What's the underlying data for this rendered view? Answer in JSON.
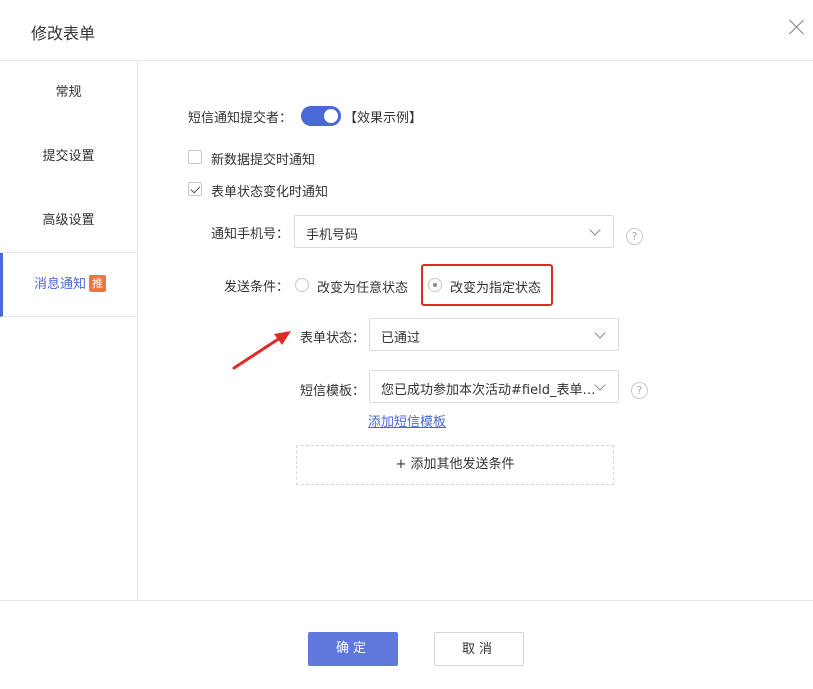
{
  "dialog": {
    "title": "修改表单"
  },
  "sidebar": {
    "items": [
      {
        "label": "常规"
      },
      {
        "label": "提交设置"
      },
      {
        "label": "高级设置"
      },
      {
        "label": "消息通知",
        "badge": "推"
      }
    ]
  },
  "main": {
    "sms_notify_label": "短信通知提交者：",
    "sms_notify_on": true,
    "effect_example": "【效果示例】",
    "new_data_notify": {
      "label": "新数据提交时通知",
      "checked": false
    },
    "status_change_notify": {
      "label": "表单状态变化时通知",
      "checked": true
    },
    "phone": {
      "label": "通知手机号：",
      "value": "手机号码",
      "help": "?"
    },
    "send_condition": {
      "label": "发送条件：",
      "options": [
        {
          "label": "改变为任意状态",
          "selected": false
        },
        {
          "label": "改变为指定状态",
          "selected": true
        }
      ]
    },
    "form_status": {
      "label": "表单状态：",
      "value": "已通过"
    },
    "sms_template": {
      "label": "短信模板：",
      "value": "您已成功参加本次活动#field_表单状态#",
      "help": "?"
    },
    "add_template_link": "添加短信模板",
    "add_condition": "+ 添加其他发送条件"
  },
  "footer": {
    "confirm": "确定",
    "cancel": "取消"
  },
  "colors": {
    "accent": "#4a68d6",
    "highlight": "#e02a2a",
    "badge": "#f0743b"
  }
}
